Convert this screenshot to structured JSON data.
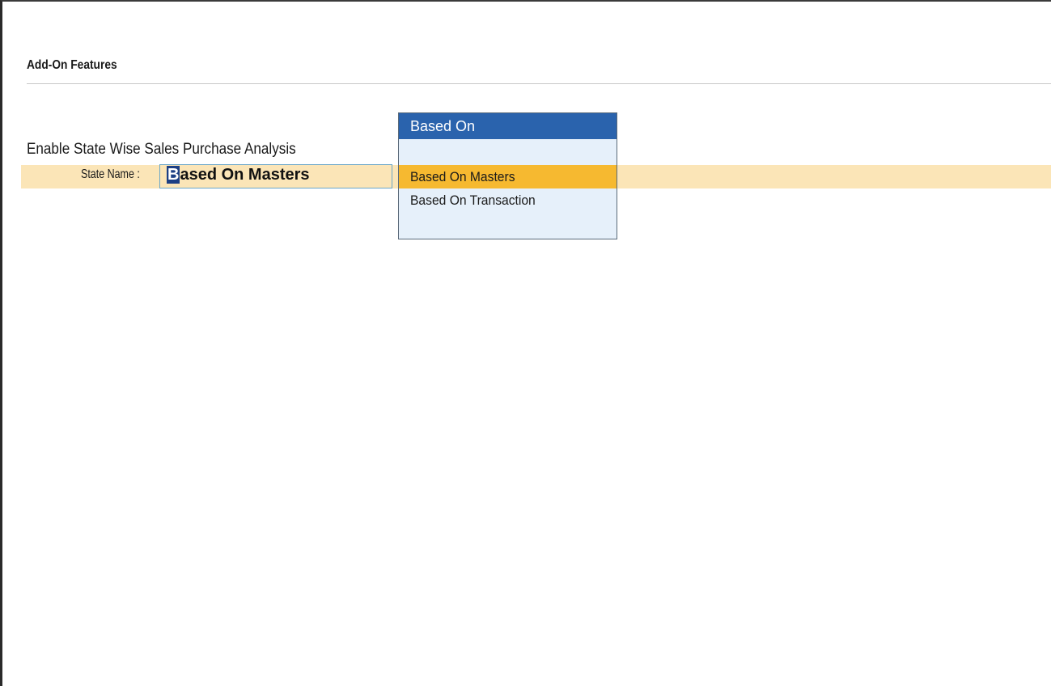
{
  "header": {
    "title": "Add-On Features"
  },
  "feature": {
    "label": "Enable State Wise Sales Purchase Analysis"
  },
  "state_field": {
    "label": "State Name :",
    "value_first": "B",
    "value_rest": "ased On Masters"
  },
  "dropdown": {
    "title": "Based On",
    "items": [
      {
        "label": "Based On Masters",
        "selected": true
      },
      {
        "label": "Based On Transaction",
        "selected": false
      }
    ]
  },
  "colors": {
    "row_highlight": "#fbe5b7",
    "dropdown_header": "#2a63ad",
    "dropdown_selected": "#f6b930",
    "dropdown_bg": "#e6f0fa"
  }
}
